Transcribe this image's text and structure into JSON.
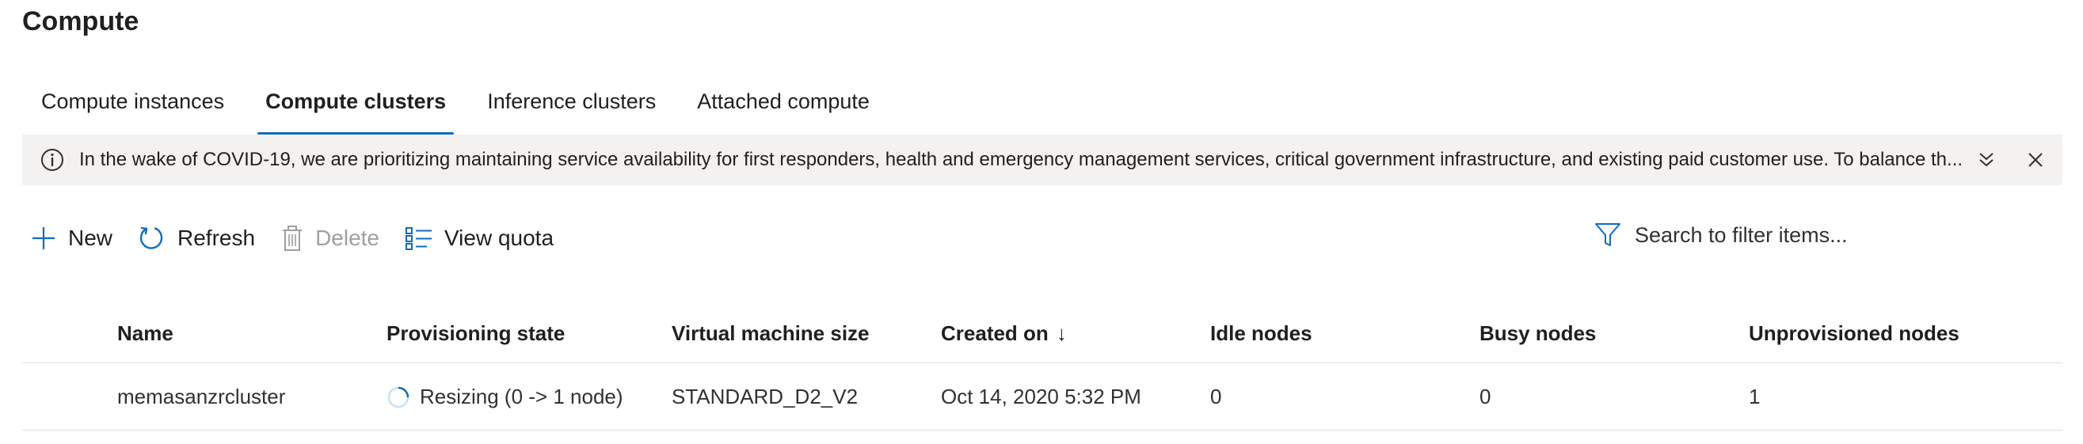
{
  "page": {
    "title": "Compute"
  },
  "tabs": [
    {
      "label": "Compute instances"
    },
    {
      "label": "Compute clusters"
    },
    {
      "label": "Inference clusters"
    },
    {
      "label": "Attached compute"
    }
  ],
  "active_tab": "Compute clusters",
  "banner": {
    "icon": "info-icon",
    "text": "In the wake of COVID-19, we are prioritizing maintaining service availability for first responders, health and emergency management services, critical government infrastructure, and existing paid customer use. To balance th..."
  },
  "toolbar": {
    "new_label": "New",
    "refresh_label": "Refresh",
    "delete_label": "Delete",
    "view_quota_label": "View quota"
  },
  "search": {
    "placeholder": "Search to filter items..."
  },
  "table": {
    "columns": [
      "Name",
      "Provisioning state",
      "Virtual machine size",
      "Created on",
      "Idle nodes",
      "Busy nodes",
      "Unprovisioned nodes"
    ],
    "sort_indicator": "↓",
    "rows": [
      {
        "name": "memasanzrcluster",
        "provisioning_state": "Resizing (0 -> 1 node)",
        "vm_size": "STANDARD_D2_V2",
        "created_on": "Oct 14, 2020 5:32 PM",
        "idle_nodes": "0",
        "busy_nodes": "0",
        "unprovisioned_nodes": "1"
      }
    ]
  },
  "colors": {
    "accent": "#0f6cbd",
    "banner_bg": "#f3f2f1",
    "disabled": "#a19f9d"
  }
}
